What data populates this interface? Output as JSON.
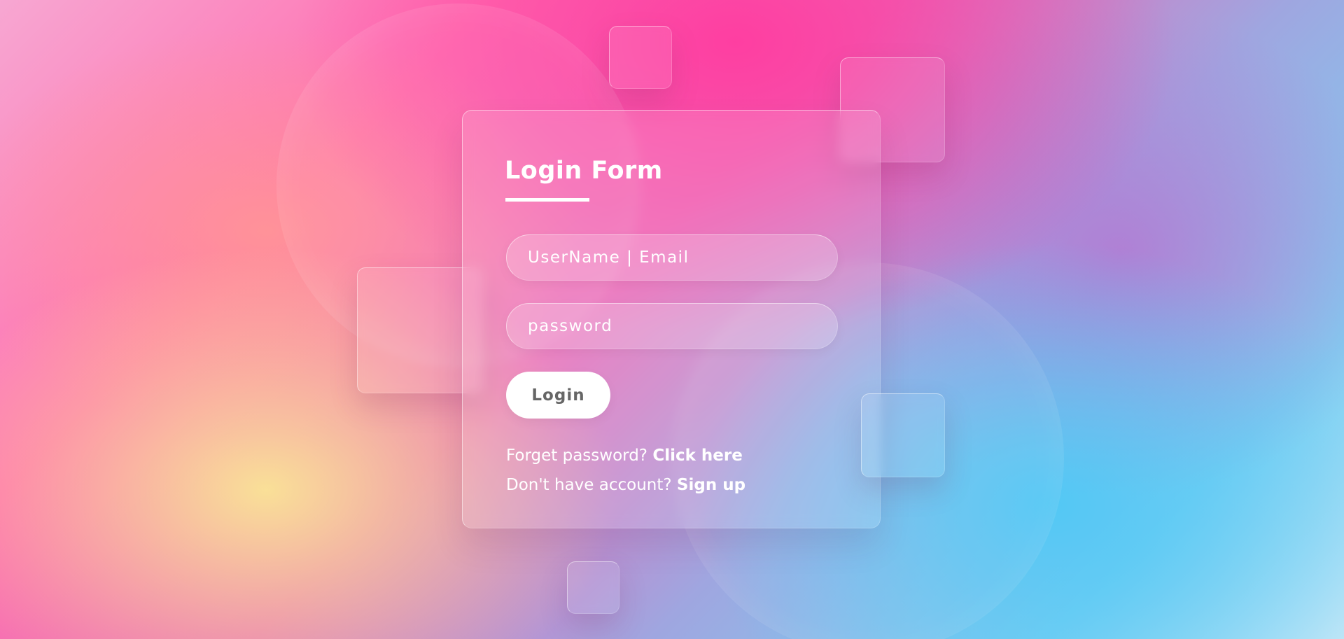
{
  "login_form": {
    "title": "Login Form",
    "username_placeholder": "UserName | Email",
    "password_placeholder": "password",
    "login_button": "Login",
    "forget_text": "Forget password?",
    "forget_link": "Click here",
    "signup_text": "Don't have account?",
    "signup_link": "Sign up"
  },
  "colors": {
    "text": "#ffffff",
    "button_background": "#ffffff",
    "button_text": "#666666",
    "background_pink": "#ff4fa8",
    "background_yellow": "#f8e39a",
    "background_blue": "#5cc6f2"
  }
}
